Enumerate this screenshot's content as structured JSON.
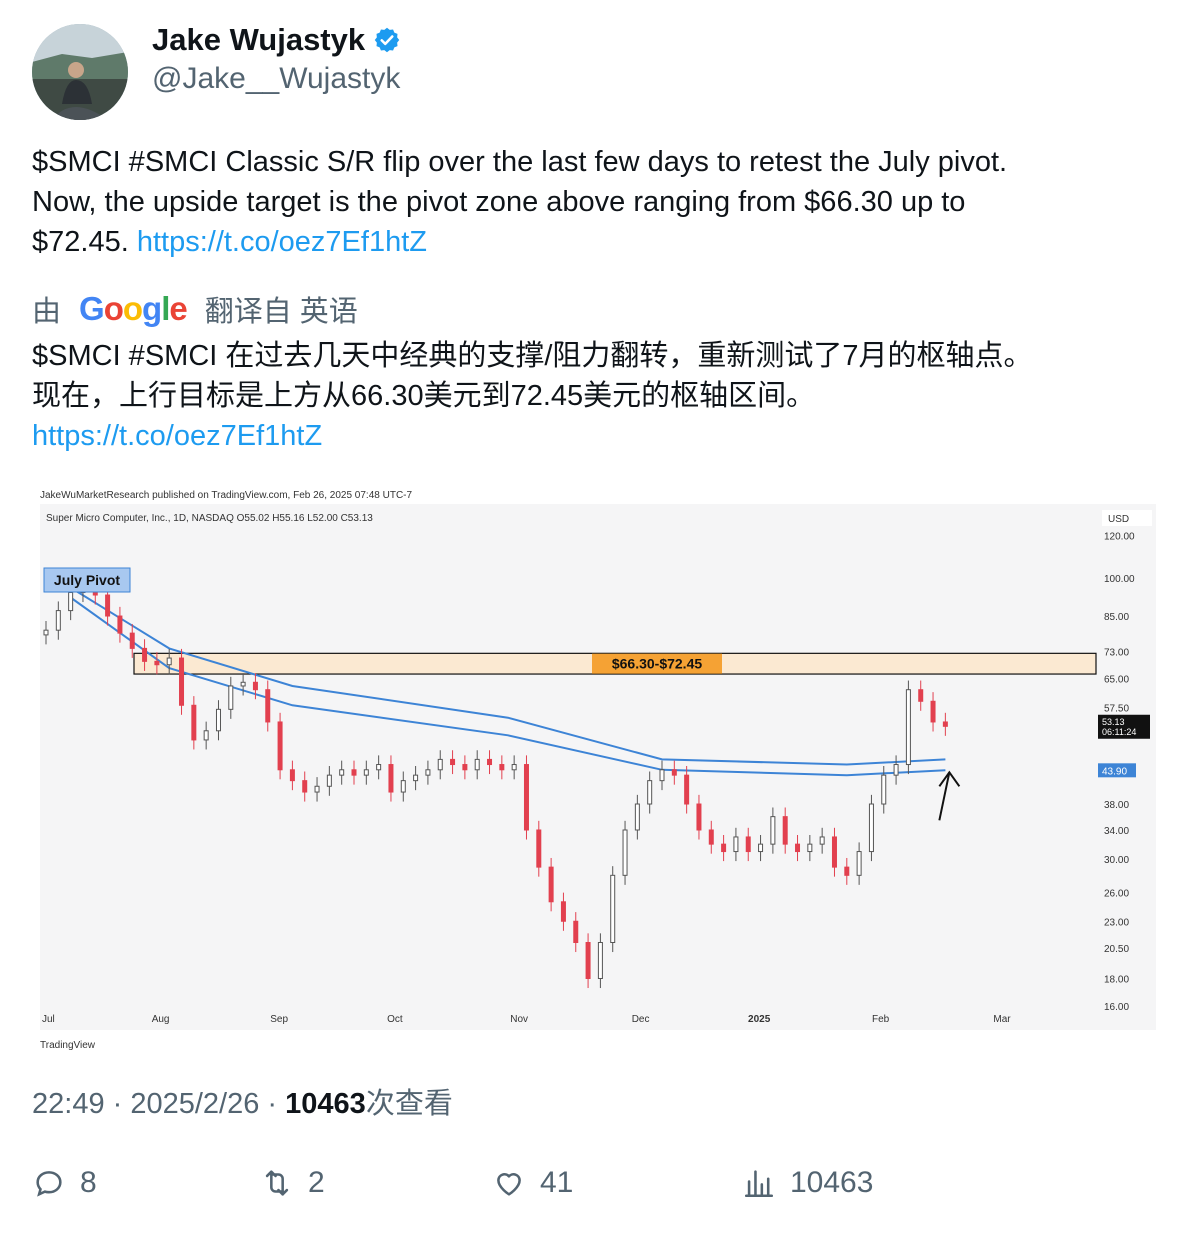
{
  "author": {
    "name": "Jake Wujastyk",
    "handle": "@Jake__Wujastyk",
    "verified_icon": "verified-badge-icon",
    "colors": {
      "verified": "#1d9bf0"
    }
  },
  "tweet": {
    "text_line1": "$SMCI #SMCI Classic S/R flip over the last few days to retest the July pivot.",
    "text_line2": "Now, the upside target is the pivot zone above ranging from $66.30 up to",
    "text_line3": "$72.45.",
    "link": "https://t.co/oez7Ef1htZ"
  },
  "translation": {
    "by_prefix": "由",
    "provider": "Google",
    "suffix": "翻译自 英语",
    "text_line1": "$SMCI #SMCI 在过去几天中经典的支撑/阻力翻转，重新测试了7月的枢轴点。",
    "text_line2": "现在，上行目标是上方从66.30美元到72.45美元的枢轴区间。",
    "link": "https://t.co/oez7Ef1htZ"
  },
  "chart_data": {
    "type": "candlestick",
    "published_line": "JakeWuMarketResearch published on TradingView.com, Feb 26, 2025 07:48 UTC-7",
    "symbol_line": "Super Micro Computer, Inc., 1D, NASDAQ  O55.02  H55.16  L52.00  C53.13",
    "currency": "USD",
    "watermark": "TradingView",
    "annotations": {
      "july_pivot": "July Pivot",
      "zone_label": "$66.30-$72.45"
    },
    "zone": [
      66.3,
      72.45
    ],
    "last_price": "53.13",
    "countdown": "06:11:24",
    "ma_price": "43.90",
    "y_scale": "log",
    "ylim": [
      16,
      135
    ],
    "y_ticks": [
      "120.00",
      "100.00",
      "85.00",
      "73.00",
      "65.00",
      "57.50",
      "43.90",
      "38.00",
      "34.00",
      "30.00",
      "26.00",
      "23.00",
      "20.50",
      "18.00",
      "16.00"
    ],
    "x_ticks": [
      "Jul",
      "Aug",
      "Sep",
      "Oct",
      "Nov",
      "Dec",
      "2025",
      "Feb",
      "Mar"
    ],
    "colors": {
      "up": "#555555",
      "down": "#e2404f",
      "ma": "#3d84d6",
      "zone_fill": "#fbe9d2",
      "zone_label_bg": "#f5a234",
      "pivot_label_bg": "#a8c8f0"
    },
    "candles_approx": [
      [
        0,
        80
      ],
      [
        4,
        87
      ],
      [
        8,
        94
      ],
      [
        12,
        95
      ],
      [
        16,
        93
      ],
      [
        20,
        85
      ],
      [
        24,
        79
      ],
      [
        28,
        74
      ],
      [
        32,
        70
      ],
      [
        36,
        69
      ],
      [
        40,
        71
      ],
      [
        44,
        58
      ],
      [
        48,
        50
      ],
      [
        52,
        52
      ],
      [
        56,
        57
      ],
      [
        60,
        63
      ],
      [
        64,
        64
      ],
      [
        68,
        62
      ],
      [
        72,
        54
      ],
      [
        76,
        44
      ],
      [
        80,
        42
      ],
      [
        84,
        40
      ],
      [
        88,
        41
      ],
      [
        92,
        43
      ],
      [
        96,
        44
      ],
      [
        100,
        43
      ],
      [
        104,
        44
      ],
      [
        108,
        45
      ],
      [
        112,
        40
      ],
      [
        116,
        42
      ],
      [
        120,
        43
      ],
      [
        124,
        44
      ],
      [
        128,
        46
      ],
      [
        132,
        45
      ],
      [
        136,
        44
      ],
      [
        140,
        46
      ],
      [
        144,
        45
      ],
      [
        148,
        44
      ],
      [
        152,
        45
      ],
      [
        156,
        34
      ],
      [
        160,
        29
      ],
      [
        164,
        25
      ],
      [
        168,
        23
      ],
      [
        172,
        21
      ],
      [
        176,
        18
      ],
      [
        180,
        21
      ],
      [
        184,
        28
      ],
      [
        188,
        34
      ],
      [
        192,
        38
      ],
      [
        196,
        42
      ],
      [
        200,
        44
      ],
      [
        204,
        43
      ],
      [
        208,
        38
      ],
      [
        212,
        34
      ],
      [
        216,
        32
      ],
      [
        220,
        31
      ],
      [
        224,
        33
      ],
      [
        228,
        31
      ],
      [
        232,
        32
      ],
      [
        236,
        36
      ],
      [
        240,
        32
      ],
      [
        244,
        31
      ],
      [
        248,
        32
      ],
      [
        252,
        33
      ],
      [
        256,
        29
      ],
      [
        260,
        28
      ],
      [
        264,
        31
      ],
      [
        268,
        38
      ],
      [
        272,
        43
      ],
      [
        276,
        45
      ],
      [
        280,
        62
      ],
      [
        284,
        59
      ],
      [
        288,
        54
      ],
      [
        292,
        53
      ]
    ],
    "ma_upper_approx": [
      [
        8,
        96
      ],
      [
        40,
        74
      ],
      [
        80,
        63
      ],
      [
        150,
        55
      ],
      [
        200,
        46
      ],
      [
        260,
        45
      ],
      [
        292,
        46
      ]
    ],
    "ma_lower_approx": [
      [
        8,
        92
      ],
      [
        40,
        68
      ],
      [
        80,
        58
      ],
      [
        150,
        51
      ],
      [
        200,
        44
      ],
      [
        260,
        43
      ],
      [
        292,
        43.9
      ]
    ]
  },
  "meta": {
    "time": "22:49",
    "date": "2025/2/26",
    "views": "10463",
    "views_suffix": "次查看"
  },
  "actions": {
    "replies": "8",
    "retweets": "2",
    "likes": "41",
    "views": "10463"
  }
}
